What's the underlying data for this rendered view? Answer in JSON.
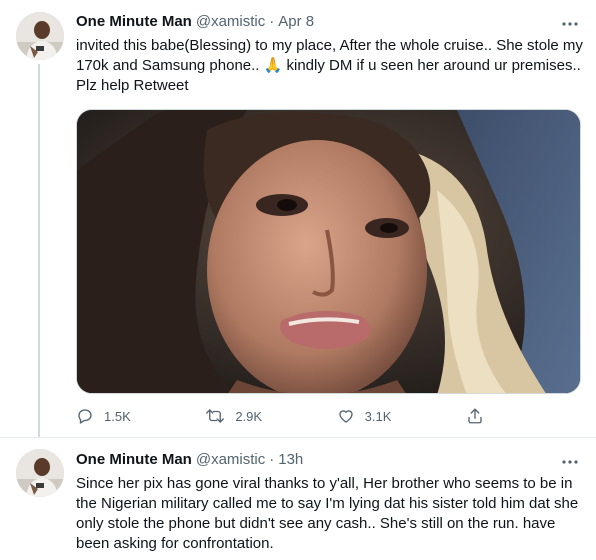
{
  "tweets": [
    {
      "author_name": "One Minute Man",
      "handle": "@xamistic",
      "separator": "·",
      "time": "Apr 8",
      "text": "invited this babe(Blessing) to my place, After the whole cruise.. She stole my 170k and Samsung phone.. 🙏 kindly DM if u seen her around ur premises.. Plz help Retweet",
      "actions": {
        "replies": "1.5K",
        "retweets": "2.9K",
        "likes": "3.1K"
      }
    },
    {
      "author_name": "One Minute Man",
      "handle": "@xamistic",
      "separator": "·",
      "time": "13h",
      "text": "Since her pix has gone viral thanks to y'all, Her brother who seems to be in the Nigerian military called me to say I'm lying dat his sister told him dat she only stole the phone but didn't see any cash.. She's still on the run. have been asking for confrontation."
    }
  ],
  "icons": {
    "more": "more-horizontal-icon",
    "reply": "reply-icon",
    "retweet": "retweet-icon",
    "like": "heart-icon",
    "share": "share-icon"
  },
  "colors": {
    "text": "#0f1419",
    "secondary": "#536471",
    "divider": "#e6ecf0",
    "thread_line": "#cfd9de"
  }
}
